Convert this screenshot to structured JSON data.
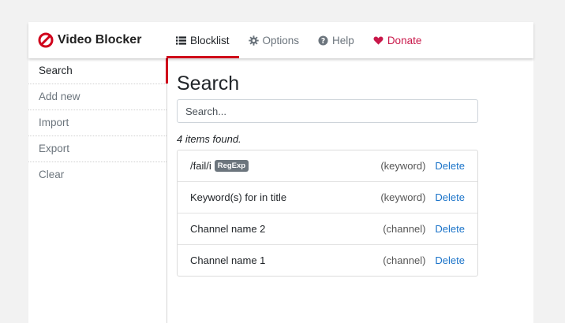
{
  "brand": {
    "name": "Video Blocker",
    "logo_icon": "blocked-circle-icon",
    "accent": "#d0021b"
  },
  "nav": [
    {
      "label": "Blocklist",
      "icon": "list-icon",
      "active": true
    },
    {
      "label": "Options",
      "icon": "gear-icon",
      "active": false
    },
    {
      "label": "Help",
      "icon": "question-circle-icon",
      "active": false
    },
    {
      "label": "Donate",
      "icon": "heart-icon",
      "active": false,
      "color": "#c9184a"
    }
  ],
  "sidebar": {
    "items": [
      {
        "label": "Search",
        "active": true
      },
      {
        "label": "Add new",
        "active": false
      },
      {
        "label": "Import",
        "active": false
      },
      {
        "label": "Export",
        "active": false
      },
      {
        "label": "Clear",
        "active": false
      }
    ]
  },
  "main": {
    "title": "Search",
    "search_placeholder": "Search...",
    "found_text": "4 items found.",
    "items": [
      {
        "text": "/fail/i",
        "badge": "RegExp",
        "type": "(keyword)",
        "action": "Delete"
      },
      {
        "text": "Keyword(s) for in title",
        "badge": "",
        "type": "(keyword)",
        "action": "Delete"
      },
      {
        "text": "Channel name 2",
        "badge": "",
        "type": "(channel)",
        "action": "Delete"
      },
      {
        "text": "Channel name 1",
        "badge": "",
        "type": "(channel)",
        "action": "Delete"
      }
    ]
  }
}
